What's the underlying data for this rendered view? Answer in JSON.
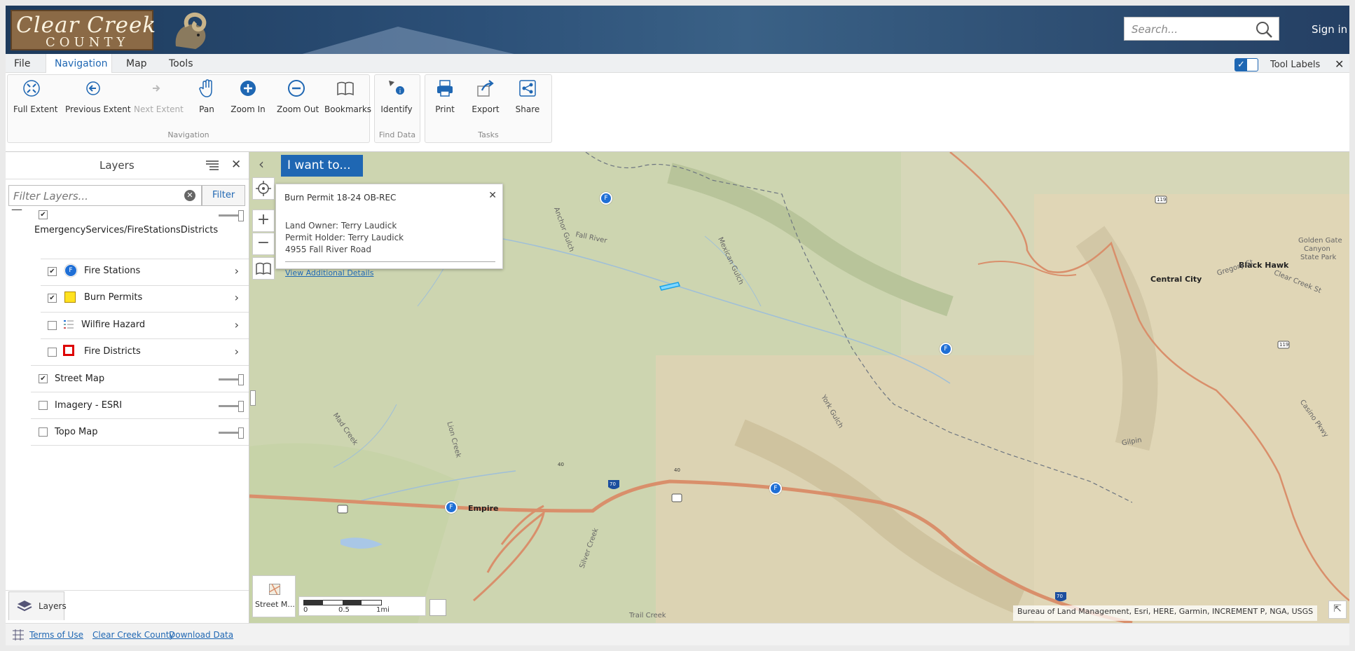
{
  "header": {
    "logo_line1": "Clear Creek",
    "logo_line2": "COUNTY",
    "search_placeholder": "Search...",
    "sign_in": "Sign in"
  },
  "menu": {
    "items": [
      "File",
      "Navigation",
      "Map",
      "Tools"
    ],
    "active": "Navigation",
    "tool_labels": "Tool Labels",
    "tool_labels_on": true
  },
  "toolbar": {
    "navigation": {
      "label": "Navigation",
      "tools": [
        "Full Extent",
        "Previous Extent",
        "Next Extent",
        "Pan",
        "Zoom In",
        "Zoom Out",
        "Bookmarks"
      ]
    },
    "find_data": {
      "label": "Find Data",
      "tools": [
        "Identify"
      ]
    },
    "tasks": {
      "label": "Tasks",
      "tools": [
        "Print",
        "Export",
        "Share"
      ]
    }
  },
  "layers": {
    "title": "Layers",
    "filter_placeholder": "Filter Layers...",
    "filter_button": "Filter",
    "group_name": "EmergencyServices/FireStationsDistricts",
    "sublayers": [
      {
        "name": "Fire Stations",
        "checked": true
      },
      {
        "name": "Burn Permits",
        "checked": true
      },
      {
        "name": "Wilfire Hazard",
        "checked": false
      },
      {
        "name": "Fire Districts",
        "checked": false
      }
    ],
    "basemaps": [
      {
        "name": "Street Map",
        "checked": true
      },
      {
        "name": "Imagery - ESRI",
        "checked": false
      },
      {
        "name": "Topo Map",
        "checked": false
      }
    ],
    "tab_label": "Layers"
  },
  "map": {
    "i_want_to": "I want to...",
    "popup": {
      "title": "Burn Permit 18-24 OB-REC",
      "land_owner": "Land Owner:  Terry Laudick",
      "permit_holder": "Permit Holder:  Terry Laudick",
      "address": "4955 Fall River Road",
      "link": "View Additional Details"
    },
    "basemap_switch": "Street M...",
    "scale": {
      "l0": "0",
      "l1": "0.5",
      "l2": "1mi"
    },
    "attribution": "Bureau of Land Management, Esri, HERE, Garmin, INCREMENT P, NGA, USGS",
    "places": {
      "empire": "Empire",
      "central_city": "Central City",
      "black_hawk": "Black Hawk",
      "golden_gate_1": "Golden Gate",
      "golden_gate_2": "Canyon",
      "golden_gate_3": "State Park",
      "fall_river": "Fall River",
      "mad_creek": "Mad Creek",
      "lion_creek": "Lion Creek",
      "york_gulch": "York Gulch",
      "gilpin": "Gilpin",
      "trail_creek": "Trail Creek",
      "silver_creek": "Silver Creek",
      "mexican_gulch": "Mexican Gulch",
      "anchor_gulch": "Anchor Gulch",
      "gregory_st": "Gregory St",
      "clear_creek_st": "Clear Creek St",
      "casino_pkwy": "Casino Pkwy",
      "hw40a": "40",
      "hw40b": "40",
      "hw70a": "70",
      "hw70b": "70",
      "hw119a": "119",
      "hw119b": "119"
    }
  },
  "footer": {
    "links": [
      "Terms of Use",
      "Clear Creek County",
      "Download Data"
    ]
  }
}
